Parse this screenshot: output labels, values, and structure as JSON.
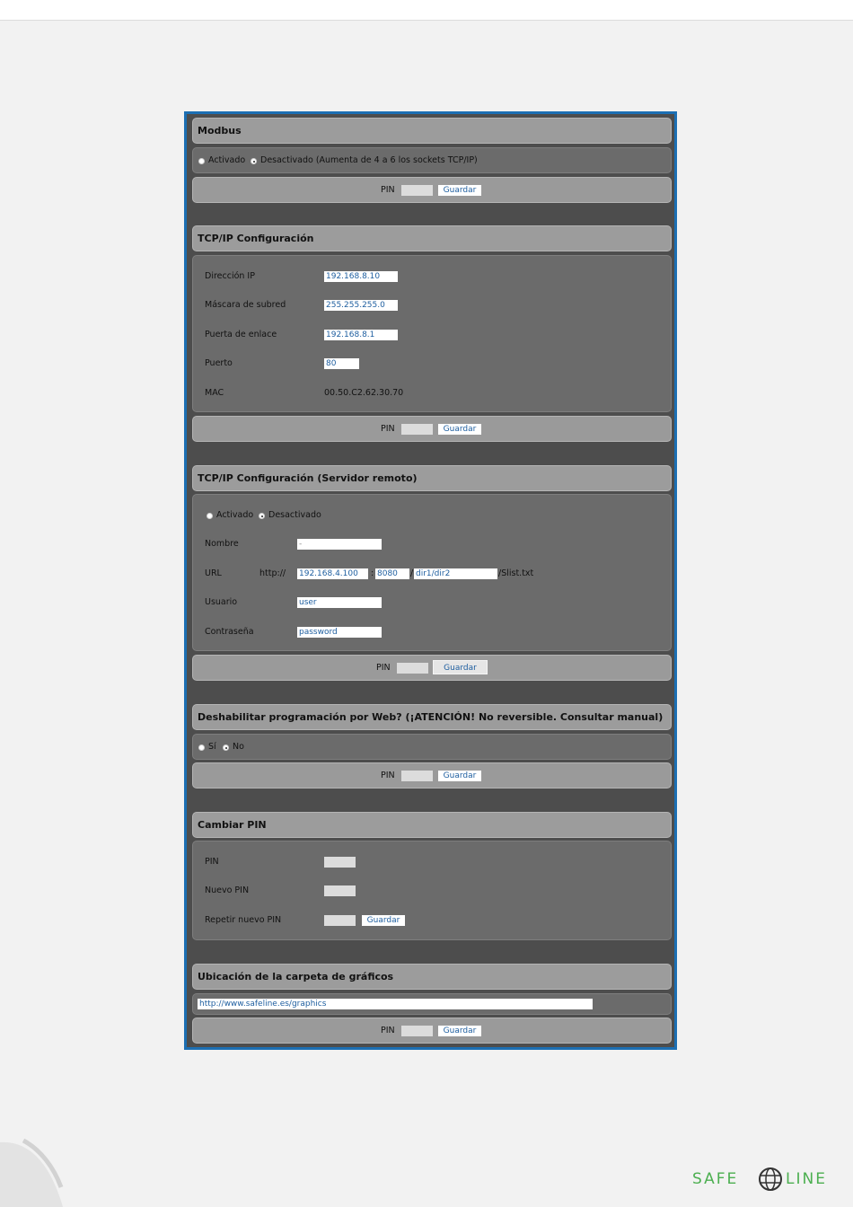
{
  "modbus": {
    "title": "Modbus",
    "opt_on": "Activado",
    "opt_off": "Desactivado (Aumenta de 4 a 6 los sockets TCP/IP)",
    "pin_label": "PIN",
    "pin_value": "",
    "save_label": "Guardar"
  },
  "tcpip": {
    "title": "TCP/IP Configuración",
    "ip_label": "Dirección IP",
    "ip_value": "192.168.8.10",
    "mask_label": "Máscara de subred",
    "mask_value": "255.255.255.0",
    "gateway_label": "Puerta de enlace",
    "gateway_value": "192.168.8.1",
    "port_label": "Puerto",
    "port_value": "80",
    "mac_label": "MAC",
    "mac_value": "00.50.C2.62.30.70",
    "pin_label": "PIN",
    "pin_value": "",
    "save_label": "Guardar"
  },
  "remote": {
    "title": "TCP/IP Configuración (Servidor remoto)",
    "opt_on": "Activado",
    "opt_off": "Desactivado",
    "name_label": "Nombre",
    "name_value": "-",
    "url_label": "URL",
    "url_prefix": "http://",
    "url_host": "192.168.4.100",
    "url_colon": ":",
    "url_port": "8080",
    "url_slash": "/",
    "url_path": "dir1/dir2",
    "url_suffix": "/Slist.txt",
    "user_label": "Usuario",
    "user_value": "user",
    "password_label": "Contraseña",
    "password_value": "password",
    "pin_label": "PIN",
    "pin_value": "",
    "save_label": "Guardar"
  },
  "disable_web": {
    "title": "Deshabilitar programación por Web? (¡ATENCIÓN! No reversible. Consultar manual)",
    "opt_yes": "Sí",
    "opt_no": "No",
    "pin_label": "PIN",
    "pin_value": "",
    "save_label": "Guardar"
  },
  "change_pin": {
    "title": "Cambiar PIN",
    "pin_label": "PIN",
    "pin_value": "",
    "new_pin_label": "Nuevo PIN",
    "new_pin_value": "",
    "repeat_pin_label": "Repetir nuevo PIN",
    "repeat_pin_value": "",
    "save_label": "Guardar"
  },
  "graphics": {
    "title": "Ubicación de la carpeta de gráficos",
    "url_value": "http://www.safeline.es/graphics",
    "pin_label": "PIN",
    "pin_value": "",
    "save_label": "Guardar"
  },
  "logo": {
    "text_left": "SAFE",
    "text_right": "LINE",
    "color": "#4caf50"
  },
  "colors": {
    "frame_border": "#1c6fb3",
    "panel_bg": "#4d4d4d",
    "header_bg": "#9c9c9c",
    "body_bg": "#6b6b6b",
    "link_text": "#1f5fa0"
  }
}
